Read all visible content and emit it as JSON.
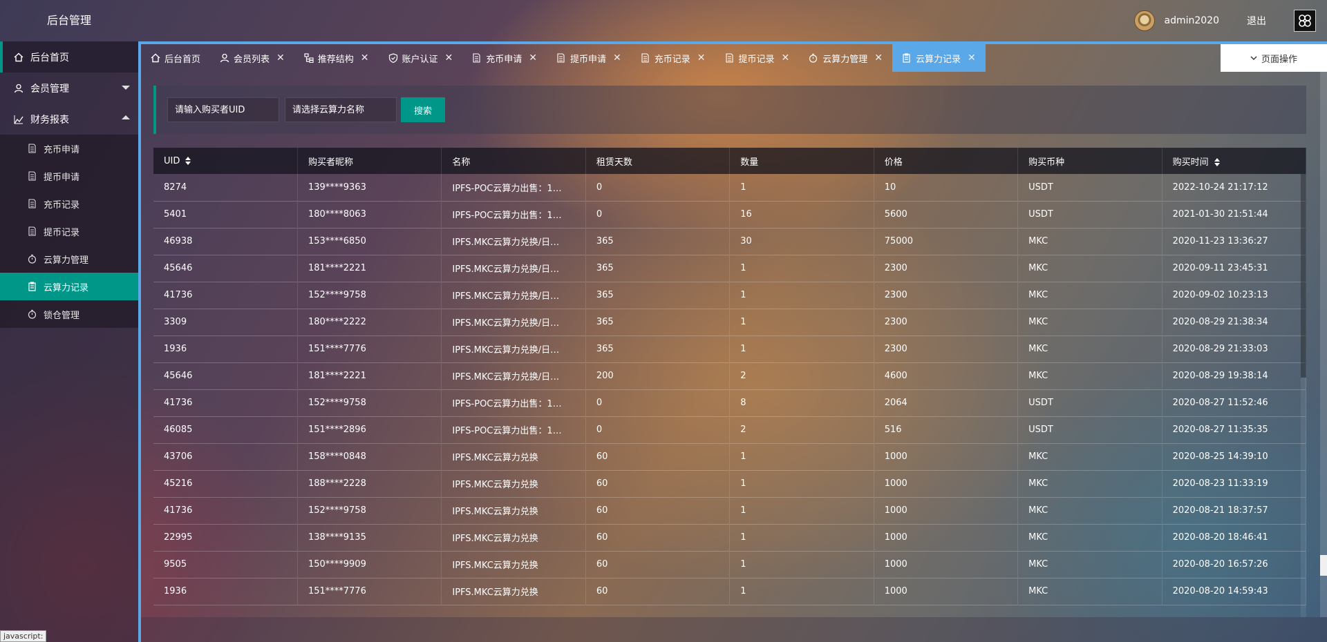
{
  "app": {
    "title": "后台管理"
  },
  "user": {
    "name": "admin2020",
    "logout": "退出"
  },
  "sidebar": {
    "items": [
      {
        "label": "后台首页",
        "icon": "home-icon"
      },
      {
        "label": "会员管理",
        "icon": "user-icon"
      },
      {
        "label": "财务报表",
        "icon": "chart-icon"
      }
    ],
    "sub": [
      {
        "label": "充币申请",
        "icon": "doc-icon"
      },
      {
        "label": "提币申请",
        "icon": "doc-icon"
      },
      {
        "label": "充币记录",
        "icon": "doc-icon"
      },
      {
        "label": "提币记录",
        "icon": "doc-icon"
      },
      {
        "label": "云算力管理",
        "icon": "timer-icon"
      },
      {
        "label": "云算力记录",
        "icon": "clipboard-icon"
      },
      {
        "label": "锁仓管理",
        "icon": "timer-icon"
      }
    ]
  },
  "tabs": [
    {
      "label": "后台首页"
    },
    {
      "label": "会员列表"
    },
    {
      "label": "推荐结构"
    },
    {
      "label": "账户认证"
    },
    {
      "label": "充币申请"
    },
    {
      "label": "提币申请"
    },
    {
      "label": "充币记录"
    },
    {
      "label": "提币记录"
    },
    {
      "label": "云算力管理"
    },
    {
      "label": "云算力记录"
    }
  ],
  "page_ops": "页面操作",
  "search": {
    "uid_placeholder": "请输入购买者UID",
    "name_placeholder": "请选择云算力名称",
    "button": "搜索"
  },
  "table": {
    "columns": [
      "UID",
      "购买者昵称",
      "名称",
      "租赁天数",
      "数量",
      "价格",
      "购买币种",
      "购买时间"
    ],
    "rows": [
      [
        "8274",
        "139****9363",
        "IPFS-POC云算力出售：1…",
        "0",
        "1",
        "10",
        "USDT",
        "2022-10-24 21:17:12"
      ],
      [
        "5401",
        "180****8063",
        "IPFS-POC云算力出售：1…",
        "0",
        "16",
        "5600",
        "USDT",
        "2021-01-30 21:51:44"
      ],
      [
        "46938",
        "153****6850",
        "IPFS.MKC云算力兑换/日…",
        "365",
        "30",
        "75000",
        "MKC",
        "2020-11-23 13:36:27"
      ],
      [
        "45646",
        "181****2221",
        "IPFS.MKC云算力兑换/日…",
        "365",
        "1",
        "2300",
        "MKC",
        "2020-09-11 23:45:31"
      ],
      [
        "41736",
        "152****9758",
        "IPFS.MKC云算力兑换/日…",
        "365",
        "1",
        "2300",
        "MKC",
        "2020-09-02 10:23:13"
      ],
      [
        "3309",
        "180****2222",
        "IPFS.MKC云算力兑换/日…",
        "365",
        "1",
        "2300",
        "MKC",
        "2020-08-29 21:38:34"
      ],
      [
        "1936",
        "151****7776",
        "IPFS.MKC云算力兑换/日…",
        "365",
        "1",
        "2300",
        "MKC",
        "2020-08-29 21:33:03"
      ],
      [
        "45646",
        "181****2221",
        "IPFS.MKC云算力兑换/日…",
        "200",
        "2",
        "4600",
        "MKC",
        "2020-08-29 19:38:14"
      ],
      [
        "41736",
        "152****9758",
        "IPFS-POC云算力出售：1…",
        "0",
        "8",
        "2064",
        "USDT",
        "2020-08-27 11:52:46"
      ],
      [
        "46085",
        "151****2896",
        "IPFS-POC云算力出售：1…",
        "0",
        "2",
        "516",
        "USDT",
        "2020-08-27 11:35:35"
      ],
      [
        "43706",
        "158****0848",
        "IPFS.MKC云算力兑换",
        "60",
        "1",
        "1000",
        "MKC",
        "2020-08-25 14:39:10"
      ],
      [
        "45216",
        "188****2228",
        "IPFS.MKC云算力兑换",
        "60",
        "1",
        "1000",
        "MKC",
        "2020-08-23 11:33:19"
      ],
      [
        "41736",
        "152****9758",
        "IPFS.MKC云算力兑换",
        "60",
        "1",
        "1000",
        "MKC",
        "2020-08-21 18:37:57"
      ],
      [
        "22995",
        "138****9135",
        "IPFS.MKC云算力兑换",
        "60",
        "1",
        "1000",
        "MKC",
        "2020-08-20 18:46:41"
      ],
      [
        "9505",
        "150****9909",
        "IPFS.MKC云算力兑换",
        "60",
        "1",
        "1000",
        "MKC",
        "2020-08-20 16:57:26"
      ],
      [
        "1936",
        "151****7776",
        "IPFS.MKC云算力兑换",
        "60",
        "1",
        "1000",
        "MKC",
        "2020-08-20 14:59:43"
      ]
    ]
  },
  "status_hint": "javascript:",
  "colors": {
    "accent": "#009688",
    "tab_active": "#5aa8e8"
  }
}
